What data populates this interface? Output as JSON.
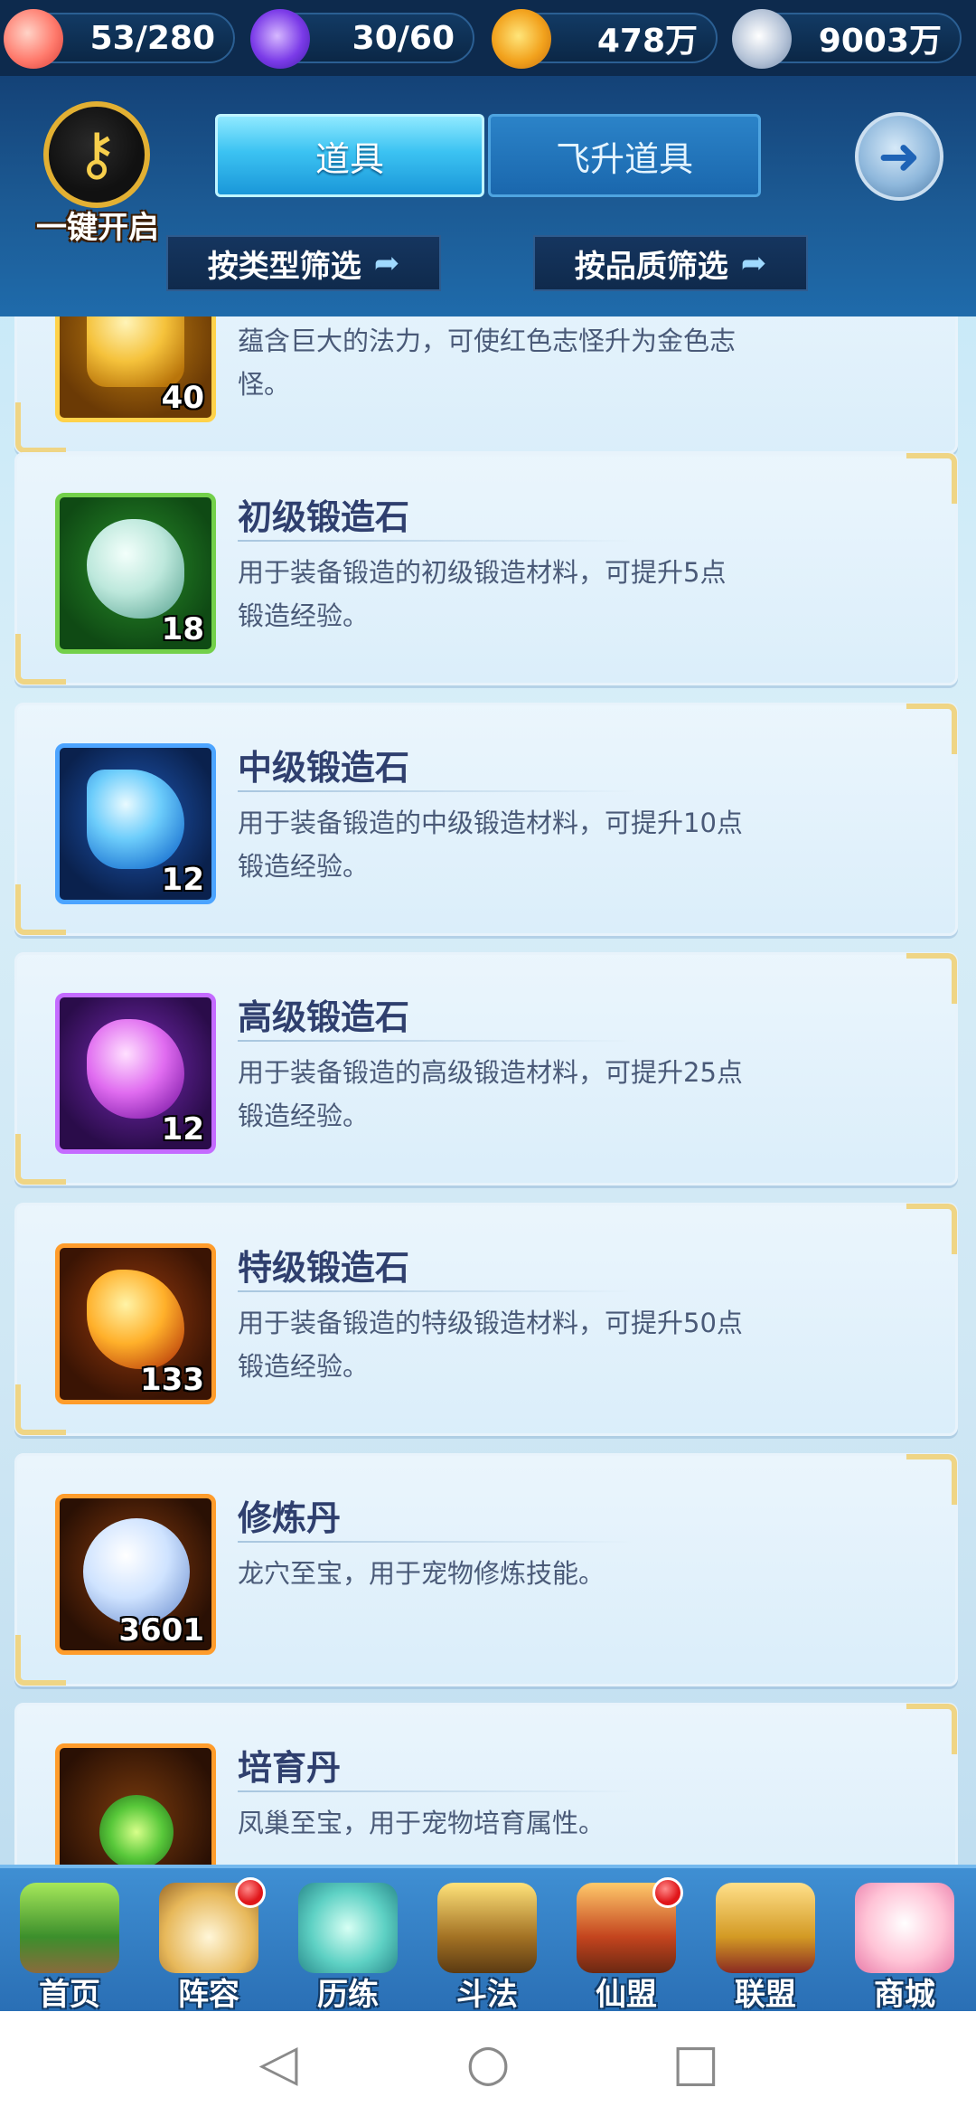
{
  "resources": {
    "peach": {
      "icon": "peach-icon",
      "value": "53/280"
    },
    "spirit": {
      "icon": "spirit-flame-icon",
      "value": "30/60"
    },
    "coin": {
      "icon": "gold-coin-icon",
      "value": "478万"
    },
    "silver": {
      "icon": "silver-coin-icon",
      "value": "9003万"
    }
  },
  "header": {
    "open_all_label": "一键开启",
    "tabs": [
      {
        "label": "道具",
        "active": true
      },
      {
        "label": "飞升道具",
        "active": false
      }
    ],
    "back_icon": "back-arrow-icon",
    "filters": {
      "type_label": "按类型筛选",
      "quality_label": "按品质筛选"
    }
  },
  "items": [
    {
      "name": "",
      "desc": "蕴含巨大的法力，可使红色志怪升为金色志怪。",
      "count": "40",
      "theme": "gold"
    },
    {
      "name": "初级锻造石",
      "desc": "用于装备锻造的初级锻造材料，可提升5点锻造经验。",
      "count": "18",
      "theme": "green"
    },
    {
      "name": "中级锻造石",
      "desc": "用于装备锻造的中级锻造材料，可提升10点锻造经验。",
      "count": "12",
      "theme": "blue"
    },
    {
      "name": "高级锻造石",
      "desc": "用于装备锻造的高级锻造材料，可提升25点锻造经验。",
      "count": "12",
      "theme": "purple"
    },
    {
      "name": "特级锻造石",
      "desc": "用于装备锻造的特级锻造材料，可提升50点锻造经验。",
      "count": "133",
      "theme": "orange"
    },
    {
      "name": "修炼丹",
      "desc": "龙穴至宝，用于宠物修炼技能。",
      "count": "3601",
      "theme": "pearl"
    },
    {
      "name": "培育丹",
      "desc": "凤巢至宝，用于宠物培育属性。",
      "count": "",
      "theme": "herb"
    }
  ],
  "bottom_nav": [
    {
      "label": "首页",
      "badge": false
    },
    {
      "label": "阵容",
      "badge": true
    },
    {
      "label": "历练",
      "badge": false
    },
    {
      "label": "斗法",
      "badge": false
    },
    {
      "label": "仙盟",
      "badge": true
    },
    {
      "label": "联盟",
      "badge": false
    },
    {
      "label": "商城",
      "badge": false
    }
  ],
  "system_nav": {
    "back_glyph": "◁",
    "home_glyph": "○",
    "recent_glyph": "□"
  }
}
